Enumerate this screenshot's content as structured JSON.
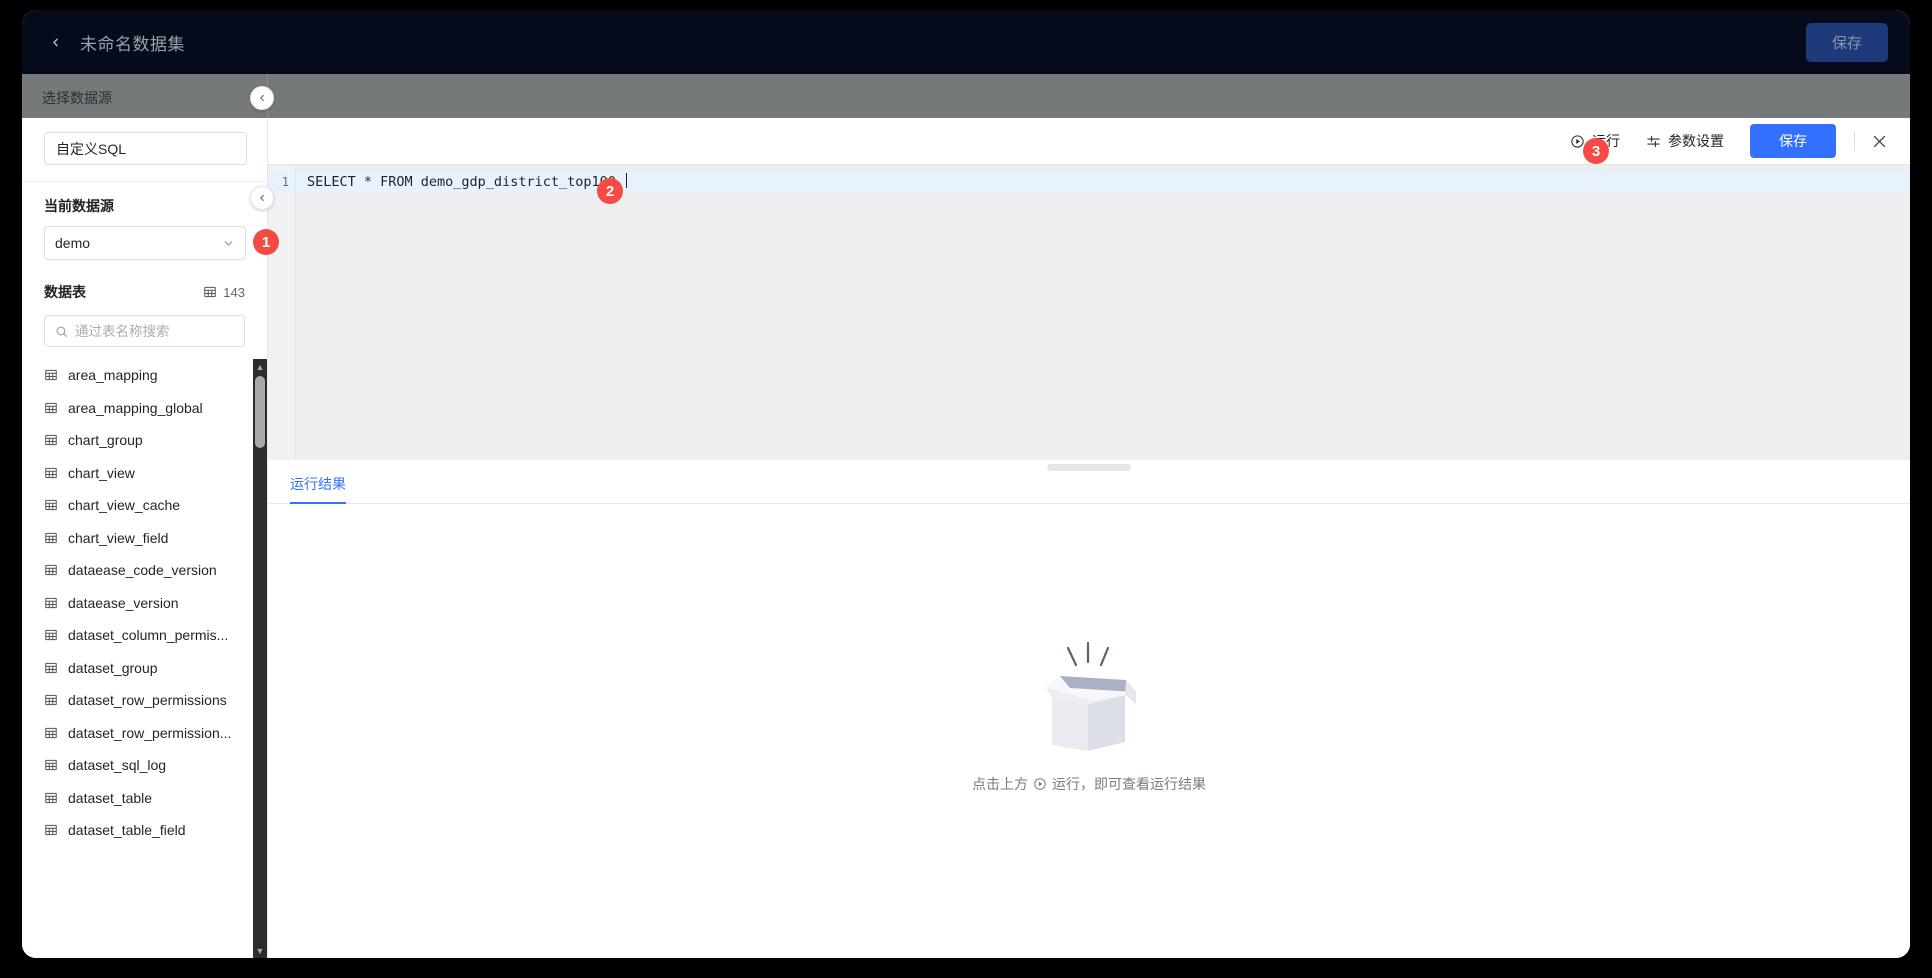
{
  "topbar": {
    "back_icon": "chevron-left-icon",
    "title": "未命名数据集",
    "save_label": "保存"
  },
  "overlay": {
    "section_label": "选择数据源",
    "collapse_icon": "chevron-left-icon"
  },
  "sidebar": {
    "sql_name_value": "自定义SQL",
    "sql_name_placeholder": "自定义SQL",
    "datasource_label": "当前数据源",
    "datasource_value": "demo",
    "datasource_chevron": "chevron-down-icon",
    "tables_label": "数据表",
    "tables_count": "143",
    "tables_count_icon": "table-icon",
    "search_placeholder": "通过表名称搜索",
    "search_value": "",
    "search_icon": "search-icon",
    "tables": [
      {
        "name": "area_mapping",
        "icon": "table-icon"
      },
      {
        "name": "area_mapping_global",
        "icon": "table-icon"
      },
      {
        "name": "chart_group",
        "icon": "table-icon"
      },
      {
        "name": "chart_view",
        "icon": "table-icon"
      },
      {
        "name": "chart_view_cache",
        "icon": "table-icon"
      },
      {
        "name": "chart_view_field",
        "icon": "table-icon"
      },
      {
        "name": "dataease_code_version",
        "icon": "table-icon"
      },
      {
        "name": "dataease_version",
        "icon": "table-icon"
      },
      {
        "name": "dataset_column_permis...",
        "icon": "table-icon"
      },
      {
        "name": "dataset_group",
        "icon": "table-icon"
      },
      {
        "name": "dataset_row_permissions",
        "icon": "table-icon"
      },
      {
        "name": "dataset_row_permission...",
        "icon": "table-icon"
      },
      {
        "name": "dataset_sql_log",
        "icon": "table-icon"
      },
      {
        "name": "dataset_table",
        "icon": "table-icon"
      },
      {
        "name": "dataset_table_field",
        "icon": "table-icon"
      }
    ],
    "scroll_up_icon": "caret-up-icon",
    "scroll_down_icon": "caret-down-icon"
  },
  "sql_panel": {
    "run_label": "运行",
    "run_icon": "play-circle-icon",
    "params_label": "参数设置",
    "params_icon": "sliders-icon",
    "save_label": "保存",
    "close_icon": "close-icon",
    "editor": {
      "line_number": "1",
      "code": "SELECT * FROM demo_gdp_district_top100 "
    },
    "results": {
      "tab_label": "运行结果",
      "empty_illustration": "empty-box-icon",
      "empty_text_before": "点击上方",
      "empty_inline_icon": "play-circle-icon",
      "empty_text_after": "运行，即可查看运行结果"
    }
  },
  "badges": {
    "one": "1",
    "two": "2",
    "three": "3",
    "color": "#f54a45"
  },
  "colors": {
    "accent": "#3370ff",
    "topbar_bg": "#050b1a",
    "editor_bg": "#eceef0",
    "active_line": "#e8f2fd"
  }
}
